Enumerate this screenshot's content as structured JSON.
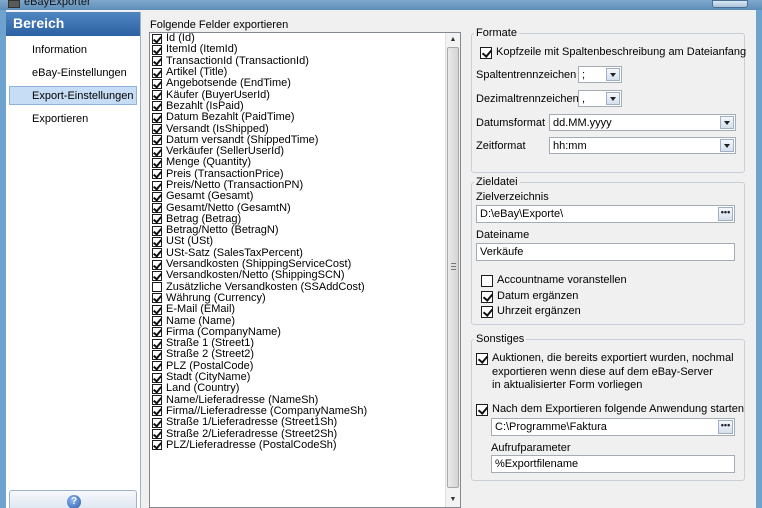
{
  "window": {
    "title": "eBayExporter"
  },
  "sidebar": {
    "header": "Bereich",
    "items": [
      {
        "label": "Information",
        "active": false
      },
      {
        "label": "eBay-Einstellungen",
        "active": false
      },
      {
        "label": "Export-Einstellungen",
        "active": true
      },
      {
        "label": "Exportieren",
        "active": false
      }
    ],
    "help_icon": "help-icon"
  },
  "fields": {
    "title": "Folgende Felder exportieren",
    "items": [
      {
        "label": "Id (Id)",
        "checked": true
      },
      {
        "label": "ItemId (ItemId)",
        "checked": true
      },
      {
        "label": "TransactionId (TransactionId)",
        "checked": true
      },
      {
        "label": "Artikel (Title)",
        "checked": true
      },
      {
        "label": "Angebotsende (EndTime)",
        "checked": true
      },
      {
        "label": "Käufer (BuyerUserId)",
        "checked": true
      },
      {
        "label": "Bezahlt (IsPaid)",
        "checked": true
      },
      {
        "label": "Datum Bezahlt (PaidTime)",
        "checked": true
      },
      {
        "label": "Versandt (IsShipped)",
        "checked": true
      },
      {
        "label": "Datum versandt (ShippedTime)",
        "checked": true
      },
      {
        "label": "Verkäufer (SellerUserId)",
        "checked": true
      },
      {
        "label": "Menge (Quantity)",
        "checked": true
      },
      {
        "label": "Preis (TransactionPrice)",
        "checked": true
      },
      {
        "label": "Preis/Netto (TransactionPN)",
        "checked": true
      },
      {
        "label": "Gesamt (Gesamt)",
        "checked": true
      },
      {
        "label": "Gesamt/Netto (GesamtN)",
        "checked": true
      },
      {
        "label": "Betrag (Betrag)",
        "checked": true
      },
      {
        "label": "Betrag/Netto (BetragN)",
        "checked": true
      },
      {
        "label": "USt (USt)",
        "checked": true
      },
      {
        "label": "USt-Satz (SalesTaxPercent)",
        "checked": true
      },
      {
        "label": "Versandkosten (ShippingServiceCost)",
        "checked": true
      },
      {
        "label": "Versandkosten/Netto (ShippingSCN)",
        "checked": true
      },
      {
        "label": "Zusätzliche Versandkosten (SSAddCost)",
        "checked": false
      },
      {
        "label": "Währung (Currency)",
        "checked": true
      },
      {
        "label": "E-Mail (EMail)",
        "checked": true
      },
      {
        "label": "Name (Name)",
        "checked": true
      },
      {
        "label": "Firma (CompanyName)",
        "checked": true
      },
      {
        "label": "Straße 1 (Street1)",
        "checked": true
      },
      {
        "label": "Straße 2 (Street2)",
        "checked": true
      },
      {
        "label": "PLZ (PostalCode)",
        "checked": true
      },
      {
        "label": "Stadt (CityName)",
        "checked": true
      },
      {
        "label": "Land (Country)",
        "checked": true
      },
      {
        "label": "Name/Lieferadresse (NameSh)",
        "checked": true
      },
      {
        "label": "Firma//Lieferadresse (CompanyNameSh)",
        "checked": true
      },
      {
        "label": "Straße 1/Lieferadresse (Street1Sh)",
        "checked": true
      },
      {
        "label": "Straße 2/Lieferadresse (Street2Sh)",
        "checked": true
      },
      {
        "label": "PLZ/Lieferadresse (PostalCodeSh)",
        "checked": true
      }
    ]
  },
  "formate": {
    "label": "Formate",
    "header_checkbox": {
      "label": "Kopfzeile mit Spaltenbeschreibung am Dateianfang",
      "checked": true
    },
    "spaltentrenn": {
      "label": "Spaltentrennzeichen",
      "value": ";"
    },
    "dezimaltrenn": {
      "label": "Dezimaltrennzeichen",
      "value": ","
    },
    "datumsformat": {
      "label": "Datumsformat",
      "value": "dd.MM.yyyy"
    },
    "zeitformat": {
      "label": "Zeitformat",
      "value": "hh:mm"
    }
  },
  "zieldatei": {
    "label": "Zieldatei",
    "verzeichnis_label": "Zielverzeichnis",
    "verzeichnis_value": "D:\\eBay\\Exporte\\",
    "dateiname_label": "Dateiname",
    "dateiname_value": "Verkäufe",
    "browse_label": "•••",
    "options": [
      {
        "label": "Accountname voranstellen",
        "checked": false
      },
      {
        "label": "Datum ergänzen",
        "checked": true
      },
      {
        "label": "Uhrzeit ergänzen",
        "checked": true
      }
    ]
  },
  "sonstiges": {
    "label": "Sonstiges",
    "auktionen": {
      "line1": "Auktionen, die bereits exportiert wurden, nochmal",
      "line2": "exportieren wenn diese auf dem eBay-Server",
      "line3": "in aktualisierter Form vorliegen",
      "checked": true
    },
    "anwendung": {
      "label": "Nach dem Exportieren folgende Anwendung starten",
      "checked": true
    },
    "anwendung_path": "C:\\Programme\\Faktura",
    "browse_label": "•••",
    "aufruf_label": "Aufrufparameter",
    "aufruf_value": "%Exportfilename"
  }
}
